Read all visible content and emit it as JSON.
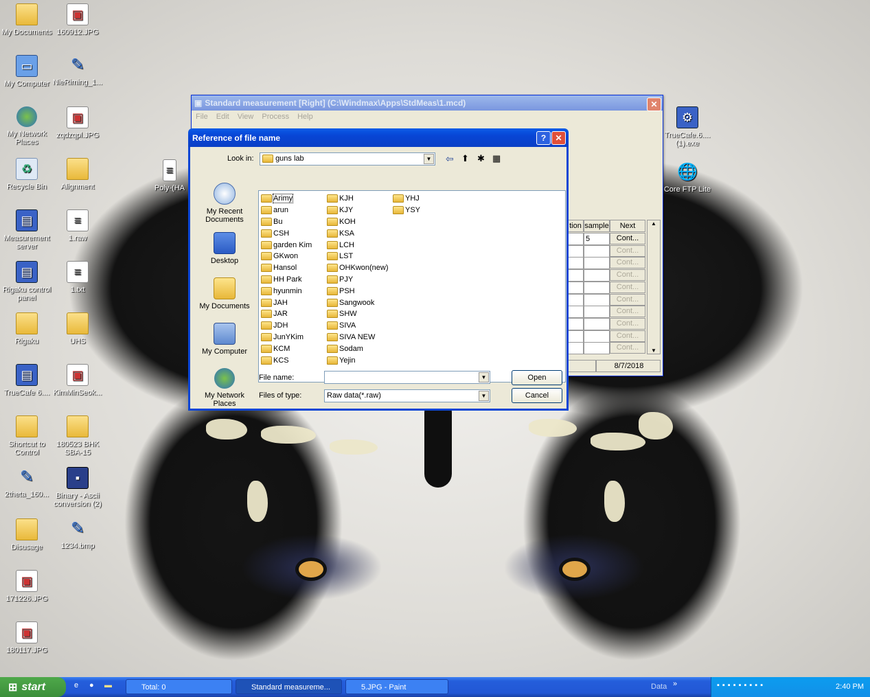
{
  "desktop": {
    "icons_left": [
      {
        "label": "My Documents",
        "icon": "folder-icon"
      },
      {
        "label": "My Computer",
        "icon": "computer-icon"
      },
      {
        "label": "My Network Places",
        "icon": "network-icon"
      },
      {
        "label": "Recycle Bin",
        "icon": "recycle-bin-icon"
      },
      {
        "label": "Measurement server",
        "icon": "app-icon"
      },
      {
        "label": "Rigaku control panel",
        "icon": "app-icon"
      },
      {
        "label": "Rigaku",
        "icon": "folder-icon"
      },
      {
        "label": "TrueCafe 6....",
        "icon": "app-icon"
      },
      {
        "label": "Shortcut to Control",
        "icon": "folder-icon"
      },
      {
        "label": "2theta_160...",
        "icon": "paint-icon"
      },
      {
        "label": "Disusage",
        "icon": "folder-icon"
      },
      {
        "label": "171226.JPG",
        "icon": "image-icon"
      },
      {
        "label": "180117.JPG",
        "icon": "image-icon"
      }
    ],
    "icons_col2": [
      {
        "label": "160912.JPG",
        "icon": "image-icon"
      },
      {
        "label": "NieRiming_1...",
        "icon": "paint-icon"
      },
      {
        "label": "zqdzqpl.JPG",
        "icon": "image-icon"
      },
      {
        "label": "Alignment",
        "icon": "folder-icon"
      },
      {
        "label": "1.raw",
        "icon": "document-icon"
      },
      {
        "label": "1.txt",
        "icon": "text-icon"
      },
      {
        "label": "UHS",
        "icon": "folder-icon"
      },
      {
        "label": "KimMinSeok...",
        "icon": "image-icon"
      },
      {
        "label": "180523 BHK SBA-15",
        "icon": "folder-icon"
      },
      {
        "label": "Binary - Ascii conversion (2)",
        "icon": "floppy-icon"
      },
      {
        "label": "1234.bmp",
        "icon": "paint-icon"
      }
    ],
    "icons_right": [
      {
        "label": "TrueCafe.6.... (1).exe",
        "icon": "app-icon"
      },
      {
        "label": "Core FTP Lite",
        "icon": "app-icon"
      }
    ],
    "partial_icon_label": "Poly-(HA"
  },
  "std_window": {
    "title": "Standard measurement [Right] (C:\\Windmax\\Apps\\StdMeas\\1.mcd)",
    "menu": [
      "File",
      "Edit",
      "View",
      "Process",
      "Help"
    ],
    "table_headers": [
      "tion",
      "sample",
      "Next"
    ],
    "first_row_sample": "5",
    "cont_label": "Cont...",
    "date": "8/7/2018"
  },
  "dialog": {
    "title": "Reference of file name",
    "look_in_label": "Look in:",
    "look_in_value": "guns lab",
    "places": [
      "My Recent Documents",
      "Desktop",
      "My Documents",
      "My Computer",
      "My Network Places"
    ],
    "folders_col1": [
      "Arimy",
      "arun",
      "Bu",
      "CSH",
      "garden Kim",
      "GKwon",
      "Hansol",
      "HH Park",
      "hyunmin",
      "JAH",
      "JAR",
      "JDH",
      "JunYKim",
      "KCM",
      "KCS"
    ],
    "folders_col2": [
      "KJH",
      "KJY",
      "KOH",
      "KSA",
      "LCH",
      "LST",
      "OHKwon(new)",
      "PJY",
      "PSH",
      "Sangwook",
      "SHW",
      "SIVA",
      "SIVA NEW",
      "Sodam",
      "Yejin"
    ],
    "folders_col3": [
      "YHJ",
      "YSY"
    ],
    "file_name_label": "File name:",
    "file_name_value": "",
    "file_type_label": "Files of type:",
    "file_type_value": "Raw data(*.raw)",
    "open_label": "Open",
    "cancel_label": "Cancel",
    "help_btn": "?",
    "close_btn": "✕"
  },
  "taskbar": {
    "start_label": "start",
    "tasks": [
      {
        "label": "Total: 0",
        "active": false
      },
      {
        "label": "Standard measureme...",
        "active": true
      },
      {
        "label": "5.JPG - Paint",
        "active": false
      }
    ],
    "data_label": "Data",
    "clock": "2:40 PM"
  }
}
